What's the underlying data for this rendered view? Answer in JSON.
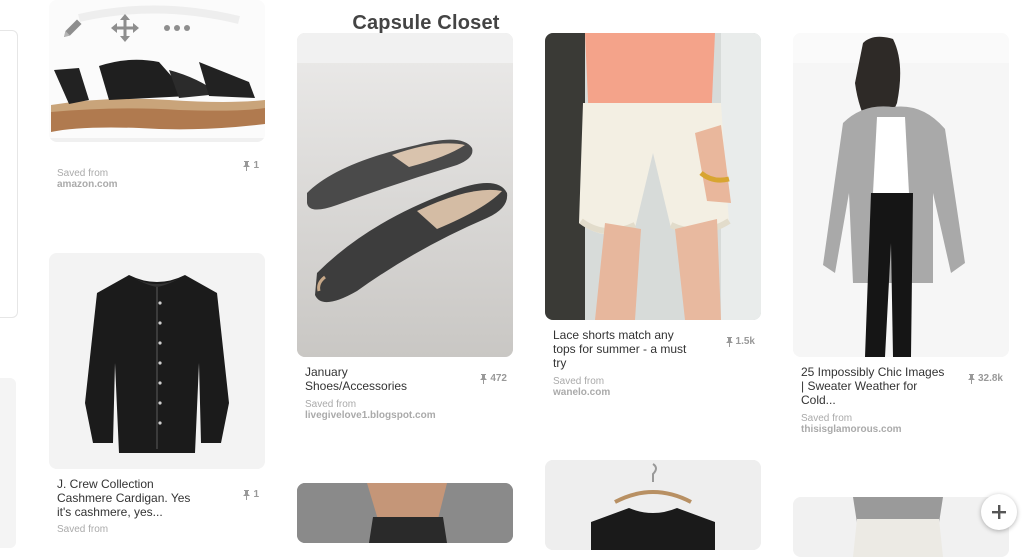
{
  "board": {
    "title": "Capsule Closet"
  },
  "toolbar": {
    "icons": [
      "pencil-icon",
      "move-icon",
      "more-icon"
    ]
  },
  "pins": [
    {
      "description": "",
      "saves": "1",
      "saved_label": "Saved from",
      "source": "amazon.com"
    },
    {
      "description": "J. Crew Collection Cashmere Cardigan. Yes it's cashmere, yes...",
      "saves": "1",
      "saved_label": "Saved from",
      "source": ""
    },
    {
      "description": "January Shoes/Accessories",
      "saves": "472",
      "saved_label": "Saved from",
      "source": "livegivelove1.blogspot.com"
    },
    {
      "description": "Lace shorts match any tops for summer - a must try",
      "saves": "1.5k",
      "saved_label": "Saved from",
      "source": "wanelo.com"
    },
    {
      "description": "25 Impossibly Chic Images | Sweater Weather for Cold...",
      "saves": "32.8k",
      "saved_label": "Saved from",
      "source": "thisisglamorous.com"
    }
  ],
  "colors": {
    "icon_gray": "#8e8e8e",
    "card_bg": "#f2f2f2"
  }
}
